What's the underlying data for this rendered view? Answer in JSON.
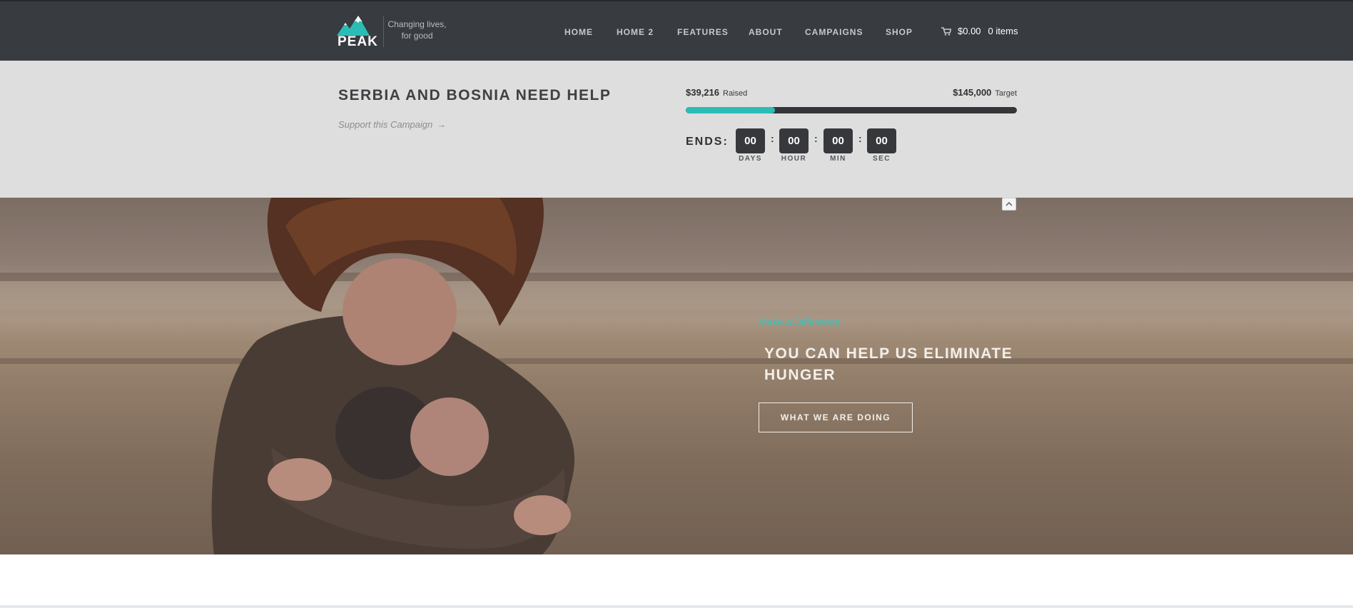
{
  "header": {
    "logo_text": "PEAK",
    "tagline_line1": "Changing lives,",
    "tagline_line2": "for good",
    "nav": [
      {
        "label": "HOME"
      },
      {
        "label": "HOME 2"
      },
      {
        "label": "FEATURES"
      },
      {
        "label": "ABOUT"
      },
      {
        "label": "CAMPAIGNS"
      },
      {
        "label": "SHOP"
      }
    ],
    "cart": {
      "icon": "cart-icon",
      "total": "$0.00",
      "items": "0 items"
    }
  },
  "campaign": {
    "title": "SERBIA AND BOSNIA NEED HELP",
    "support_link": "Support this Campaign",
    "raised_amount": "$39,216",
    "raised_label": "Raised",
    "target_amount": "$145,000",
    "target_label": "Target",
    "progress_fraction": 0.27,
    "ends_label": "ENDS:",
    "countdown": [
      {
        "value": "00",
        "unit": "DAYS"
      },
      {
        "value": "00",
        "unit": "HOUR"
      },
      {
        "value": "00",
        "unit": "MIN"
      },
      {
        "value": "00",
        "unit": "SEC"
      }
    ],
    "separator": ":"
  },
  "hero": {
    "kicker": "Make a Difference",
    "heading": "YOU CAN HELP US ELIMINATE HUNGER",
    "button_label": "WHAT WE ARE DOING"
  },
  "colors": {
    "header_bg": "#383b40",
    "accent": "#2bbdb5",
    "campaign_bg": "#dedede",
    "countdown_box": "#36383c"
  }
}
